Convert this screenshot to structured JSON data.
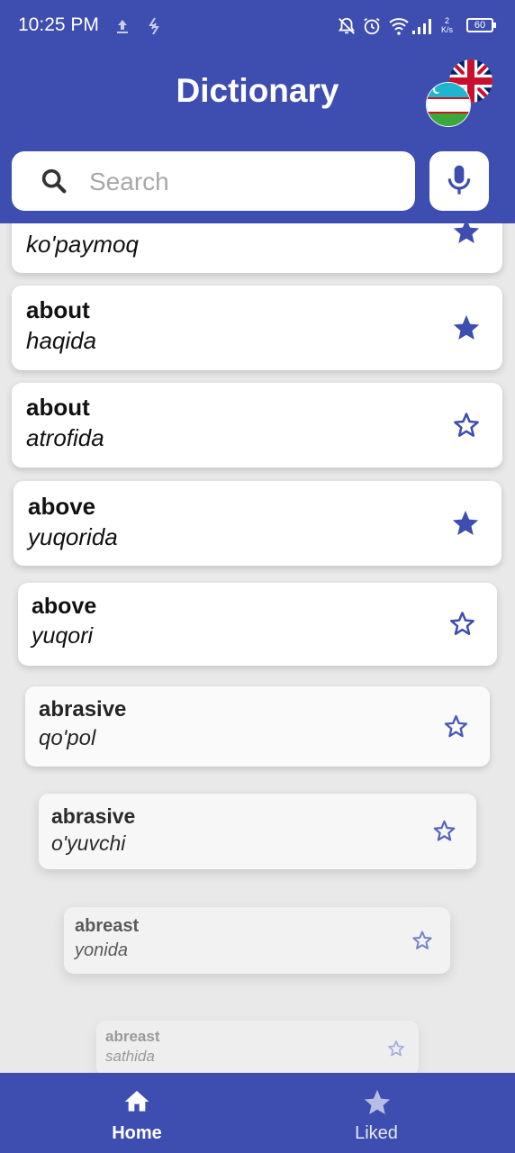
{
  "status_bar": {
    "time": "10:25 PM",
    "network_speed_value": "2",
    "network_speed_unit": "K/s",
    "battery": "60"
  },
  "header": {
    "title": "Dictionary",
    "search_placeholder": "Search"
  },
  "entries": [
    {
      "word": "",
      "translation": "ko'paymoq",
      "liked": true
    },
    {
      "word": "about",
      "translation": "haqida",
      "liked": true
    },
    {
      "word": "about",
      "translation": "atrofida",
      "liked": false
    },
    {
      "word": "above",
      "translation": "yuqorida",
      "liked": true
    },
    {
      "word": "above",
      "translation": "yuqori",
      "liked": false
    },
    {
      "word": "abrasive",
      "translation": "qo'pol",
      "liked": false
    },
    {
      "word": "abrasive",
      "translation": "o'yuvchi",
      "liked": false
    },
    {
      "word": "abreast",
      "translation": "yonida",
      "liked": false
    },
    {
      "word": "abreast",
      "translation": "sathida",
      "liked": false
    }
  ],
  "bottom_nav": {
    "home_label": "Home",
    "liked_label": "Liked"
  },
  "colors": {
    "primary": "#3d4db0",
    "star": "#3d4db0",
    "background": "#e9e9e9"
  }
}
